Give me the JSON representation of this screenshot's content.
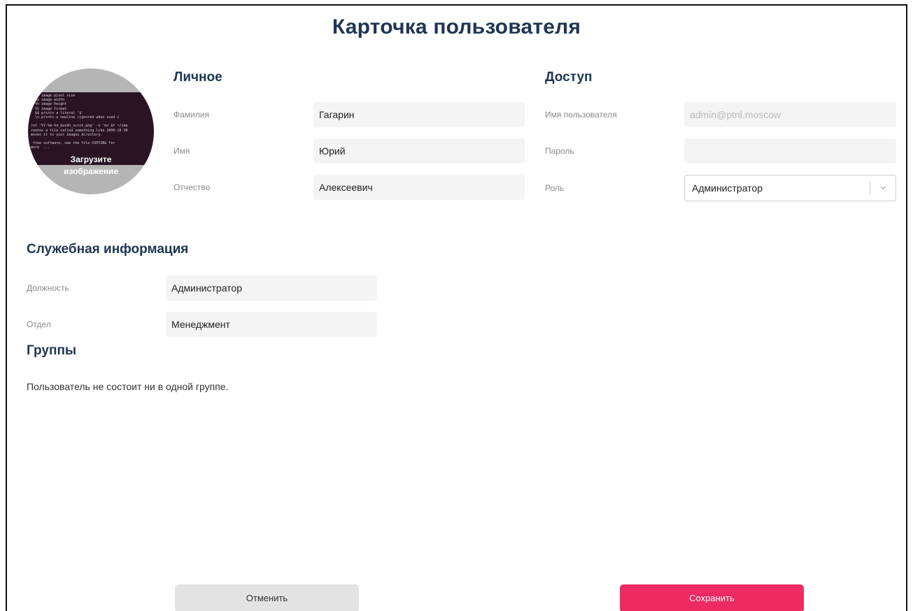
{
  "page": {
    "title": "Карточка пользователя"
  },
  "avatar": {
    "caption_line1": "Загрузите",
    "caption_line2": "изображение",
    "screen_text": "  %  image pixel size\n  %w image width\n  %h image height\n  %t image format\n  $$ prints a literal '$'\n  \\n prints a newline (ignored when used i\n\nrot '%Y-%m-%d_$wx$h_scrot.png' -e 'mv $f ~/ima\nreates a file called something like 2000-10-30\nmoves it to your images directory.\n\n free software, see the file COPYING for\nmore  ..."
  },
  "personal": {
    "title": "Личное",
    "last_name": {
      "label": "Фамилия",
      "value": "Гагарин"
    },
    "first_name": {
      "label": "Имя",
      "value": "Юрий"
    },
    "middle_name": {
      "label": "Отчество",
      "value": "Алексеевич"
    }
  },
  "access": {
    "title": "Доступ",
    "username": {
      "label": "Имя пользователя",
      "placeholder": "admin@ptnl.moscow"
    },
    "password": {
      "label": "Пароль",
      "value": ""
    },
    "role": {
      "label": "Роль",
      "value": "Администратор",
      "icon": "chevron-down-icon"
    }
  },
  "work": {
    "title": "Служебная информация",
    "position": {
      "label": "Должность",
      "value": "Администратор"
    },
    "department": {
      "label": "Отдел",
      "value": "Менеджмент"
    }
  },
  "groups": {
    "title": "Группы",
    "empty_text": "Пользователь не состоит ни в одной группе."
  },
  "actions": {
    "cancel_label": "Отменить",
    "save_label": "Сохранить",
    "save_color": "#ee2a62",
    "cancel_color": "#e3e3e3"
  },
  "colors": {
    "heading": "#1f3554"
  }
}
